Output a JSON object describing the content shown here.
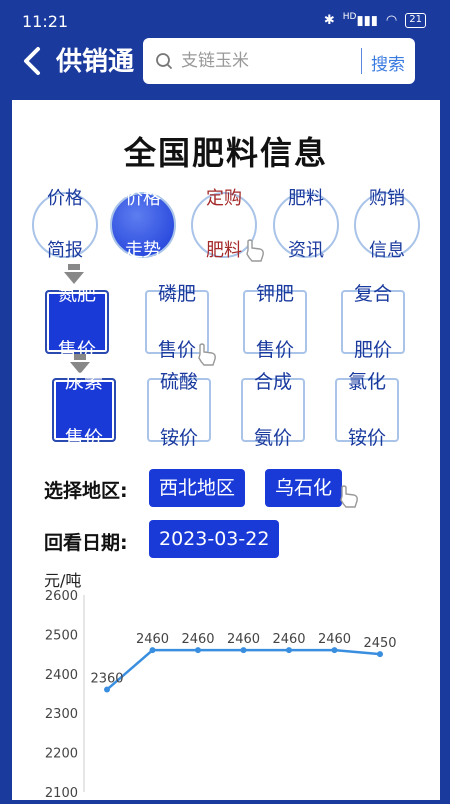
{
  "status": {
    "time": "11:21",
    "battery": "21",
    "signal": "HD"
  },
  "header": {
    "back_icon": "back-arrow-icon",
    "title": "供销通"
  },
  "search": {
    "placeholder": "支链玉米",
    "button": "搜索"
  },
  "page_title": "全国肥料信息",
  "circle_tabs": [
    {
      "line1": "价格",
      "line2": "简报"
    },
    {
      "line1": "价格",
      "line2": "走势"
    },
    {
      "line1": "定购",
      "line2": "肥料"
    },
    {
      "line1": "肥料",
      "line2": "资讯"
    },
    {
      "line1": "购销",
      "line2": "信息"
    }
  ],
  "categories_row1": [
    {
      "line1": "氮肥",
      "line2": "售价"
    },
    {
      "line1": "磷肥",
      "line2": "售价"
    },
    {
      "line1": "钾肥",
      "line2": "售价"
    },
    {
      "line1": "复合",
      "line2": "肥价"
    }
  ],
  "categories_row2": [
    {
      "line1": "尿素",
      "line2": "售价"
    },
    {
      "line1": "硫酸",
      "line2": "铵价"
    },
    {
      "line1": "合成",
      "line2": "氨价"
    },
    {
      "line1": "氯化",
      "line2": "铵价"
    }
  ],
  "filters": {
    "region_label": "选择地区:",
    "region_1": "西北地区",
    "region_2": "乌石化",
    "date_label": "回看日期:",
    "date_value": "2023-03-22"
  },
  "chart_data": {
    "type": "line",
    "ylabel": "元/吨",
    "ylim": [
      2100,
      2600
    ],
    "yticks": [
      2600,
      2500,
      2400,
      2300,
      2200,
      2100
    ],
    "x": [
      1,
      2,
      3,
      4,
      5,
      6,
      7
    ],
    "values": [
      2360,
      2460,
      2460,
      2460,
      2460,
      2460,
      2450
    ],
    "labels": [
      "2360",
      "2460",
      "2460",
      "2460",
      "2460",
      "2460",
      "2450"
    ],
    "line_color": "#3a8ee0"
  },
  "colors": {
    "accent": "#1a3ad8",
    "header_bg": "#1a3a9e"
  }
}
